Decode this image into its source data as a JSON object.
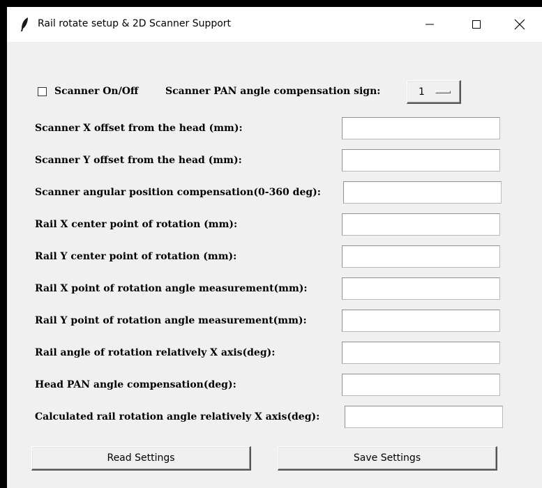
{
  "window": {
    "title": "Rail rotate setup & 2D Scanner Support",
    "icon": "feather-icon",
    "controls": [
      "minimize-icon",
      "maximize-icon",
      "close-icon"
    ]
  },
  "scanner": {
    "onoff_label": "Scanner On/Off",
    "onoff_checked": false,
    "pan_sign_label": "Scanner PAN angle compensation sign:",
    "pan_sign_value": "1"
  },
  "fields": [
    {
      "label": "Scanner X offset from the head (mm):",
      "value": ""
    },
    {
      "label": "Scanner Y offset from the head (mm):",
      "value": ""
    },
    {
      "label": "Scanner angular position compensation(0-360 deg):",
      "value": ""
    },
    {
      "label": "Rail X center point of rotation (mm):",
      "value": ""
    },
    {
      "label": "Rail Y center point of rotation (mm):",
      "value": ""
    },
    {
      "label": "Rail X point of rotation angle measurement(mm):",
      "value": ""
    },
    {
      "label": "Rail Y point of rotation angle measurement(mm):",
      "value": ""
    },
    {
      "label": "Rail angle of rotation relatively X axis(deg):",
      "value": ""
    },
    {
      "label": "Head PAN angle compensation(deg):",
      "value": ""
    },
    {
      "label": "Calculated rail rotation angle relatively X axis(deg):",
      "value": ""
    }
  ],
  "buttons": {
    "read_label": "Read Settings",
    "save_label": "Save Settings"
  },
  "colors": {
    "background": "#f0f0f0",
    "titlebar": "#ffffff",
    "frame": "#000000"
  }
}
